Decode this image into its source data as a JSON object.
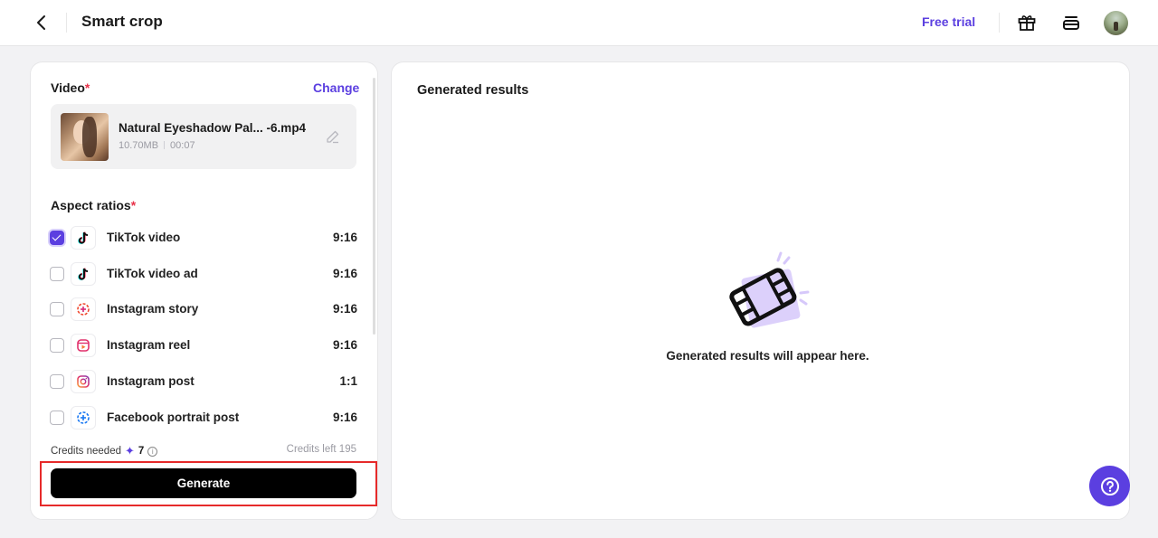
{
  "header": {
    "title": "Smart crop",
    "free_trial_label": "Free trial",
    "icons": [
      "back-arrow-icon",
      "gift-icon",
      "stack-icon",
      "user-avatar"
    ]
  },
  "video_section": {
    "label": "Video",
    "required_mark": "*",
    "change_label": "Change",
    "file": {
      "name": "Natural Eyeshadow Pal... -6.mp4",
      "size": "10.70MB",
      "duration": "00:07"
    }
  },
  "aspect_section": {
    "label": "Aspect ratios",
    "required_mark": "*",
    "items": [
      {
        "label": "TikTok video",
        "ratio": "9:16",
        "checked": true,
        "icon": "tiktok-icon"
      },
      {
        "label": "TikTok video ad",
        "ratio": "9:16",
        "checked": false,
        "icon": "tiktok-icon"
      },
      {
        "label": "Instagram story",
        "ratio": "9:16",
        "checked": false,
        "icon": "instagram-story-icon"
      },
      {
        "label": "Instagram reel",
        "ratio": "9:16",
        "checked": false,
        "icon": "instagram-reel-icon"
      },
      {
        "label": "Instagram post",
        "ratio": "1:1",
        "checked": false,
        "icon": "instagram-icon"
      },
      {
        "label": "Facebook portrait post",
        "ratio": "9:16",
        "checked": false,
        "icon": "facebook-story-icon"
      }
    ]
  },
  "credits": {
    "needed_label": "Credits needed",
    "needed_value": "7",
    "left_label": "Credits left 195"
  },
  "generate_label": "Generate",
  "results": {
    "title": "Generated results",
    "empty_text": "Generated results will appear here."
  },
  "colors": {
    "accent": "#5b3fe0",
    "required": "#e8334a",
    "highlight_border": "#e62a2a"
  }
}
